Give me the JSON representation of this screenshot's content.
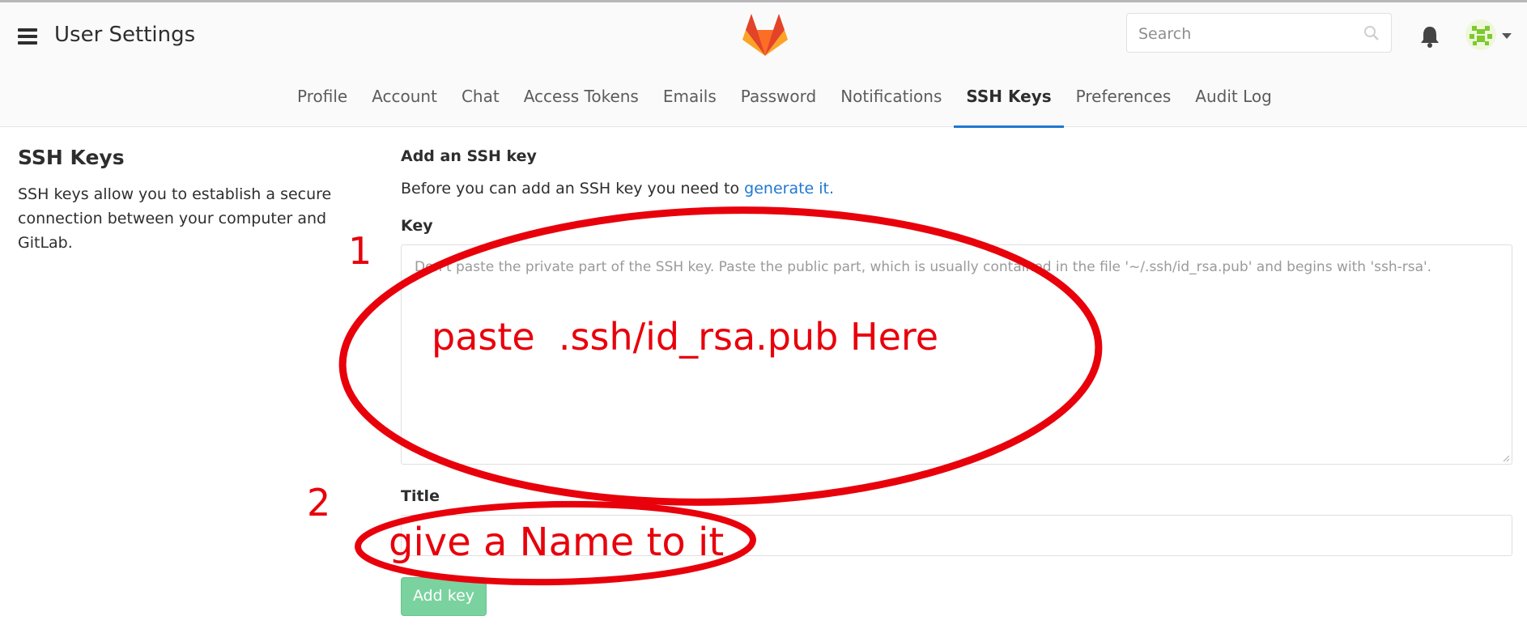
{
  "header": {
    "title": "User Settings",
    "search_placeholder": "Search"
  },
  "tabs": [
    {
      "label": "Profile",
      "active": false
    },
    {
      "label": "Account",
      "active": false
    },
    {
      "label": "Chat",
      "active": false
    },
    {
      "label": "Access Tokens",
      "active": false
    },
    {
      "label": "Emails",
      "active": false
    },
    {
      "label": "Password",
      "active": false
    },
    {
      "label": "Notifications",
      "active": false
    },
    {
      "label": "SSH Keys",
      "active": true
    },
    {
      "label": "Preferences",
      "active": false
    },
    {
      "label": "Audit Log",
      "active": false
    }
  ],
  "sidebar": {
    "heading": "SSH Keys",
    "description": "SSH keys allow you to establish a secure connection between your computer and GitLab."
  },
  "form": {
    "heading": "Add an SSH key",
    "intro_text": "Before you can add an SSH key you need to ",
    "intro_link": "generate it.",
    "key_label": "Key",
    "key_placeholder": "Don't paste the private part of the SSH key. Paste the public part, which is usually contained in the file '~/.ssh/id_rsa.pub' and begins with 'ssh-rsa'.",
    "title_label": "Title",
    "submit_label": "Add key"
  },
  "annotations": {
    "step1_number": "1",
    "step1_text": "paste  .ssh/id_rsa.pub Here",
    "step2_number": "2",
    "step2_text": "give a Name to it"
  },
  "colors": {
    "accent": "#1f78d1",
    "annotation": "#e8000b",
    "button": "#6fcf97"
  },
  "icons": [
    "hamburger-icon",
    "gitlab-logo",
    "search-icon",
    "bell-icon",
    "avatar",
    "chevron-down-icon"
  ]
}
